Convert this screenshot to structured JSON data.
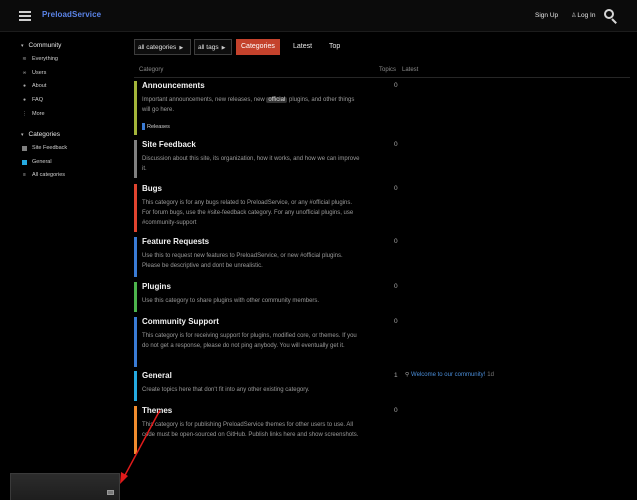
{
  "header": {
    "brand": "PreloadService",
    "signup": "Sign Up",
    "login": "Log In",
    "person_glyph": "♙"
  },
  "sidebar": {
    "community_label": "Community",
    "community_items": [
      {
        "label": "Everything",
        "icon": "layers-icon",
        "glyph": "≋"
      },
      {
        "label": "Users",
        "icon": "users-icon",
        "glyph": "∞"
      },
      {
        "label": "About",
        "icon": "info-icon",
        "glyph": "●"
      },
      {
        "label": "FAQ",
        "icon": "question-icon",
        "glyph": "●"
      },
      {
        "label": "More",
        "icon": "more-icon",
        "glyph": "⋮"
      }
    ],
    "categories_label": "Categories",
    "category_items": [
      {
        "label": "Site Feedback",
        "color": "#808080"
      },
      {
        "label": "General",
        "color": "#25aae1"
      }
    ],
    "all_categories": "All categories",
    "chevron_glyph": "▾"
  },
  "toolbar": {
    "all_categories": "all categories",
    "all_tags": "all tags",
    "caret": "▶",
    "tabs": [
      "Categories",
      "Latest",
      "Top"
    ]
  },
  "table": {
    "col_category": "Category",
    "col_topics": "Topics",
    "col_latest": "Latest",
    "categories": [
      {
        "name": "Announcements",
        "desc_before": "Important announcements, new releases, new ",
        "desc_chip": "official",
        "desc_after": " plugins, and other things will go here.",
        "topics": "0",
        "color": "#a3b53a",
        "sub": "Releases",
        "sub_color": "#3a7bd5"
      },
      {
        "name": "Site Feedback",
        "desc": "Discussion about this site, its organization, how it works, and how we can improve it.",
        "topics": "0",
        "color": "#808080"
      },
      {
        "name": "Bugs",
        "desc": "This category is for any bugs related to PreloadService, or any #official plugins. For forum bugs, use the #site-feedback category. For any unofficial plugins, use #community-support",
        "topics": "0",
        "color": "#e0442f"
      },
      {
        "name": "Feature Requests",
        "desc": "Use this to request new features to PreloadService, or new #official plugins. Please be descriptive and dont be unrealistic.",
        "topics": "0",
        "color": "#3a7bd5"
      },
      {
        "name": "Plugins",
        "desc": "Use this category to share plugins with other community members.",
        "topics": "0",
        "color": "#4cb34c"
      },
      {
        "name": "Community Support",
        "desc": "This category is for receiving support for plugins, modified core, or themes. If you do not get a response, please do not ping anybody. You will eventually get it.",
        "topics": "0",
        "color": "#3a7bd5"
      },
      {
        "name": "General",
        "desc": "Create topics here that don't fit into any other existing category.",
        "topics": "1",
        "color": "#25aae1",
        "latest_title": "Welcome to our community!",
        "latest_age": "1d",
        "pin_glyph": "⚲"
      },
      {
        "name": "Themes",
        "desc": "This category is for publishing PreloadService themes for other users to use. All code must be open-sourced on GitHub. Publish links here and show screenshots.",
        "topics": "0",
        "color": "#f08c2e"
      }
    ]
  },
  "annotation": {
    "arrow_color": "#e01b1b"
  }
}
